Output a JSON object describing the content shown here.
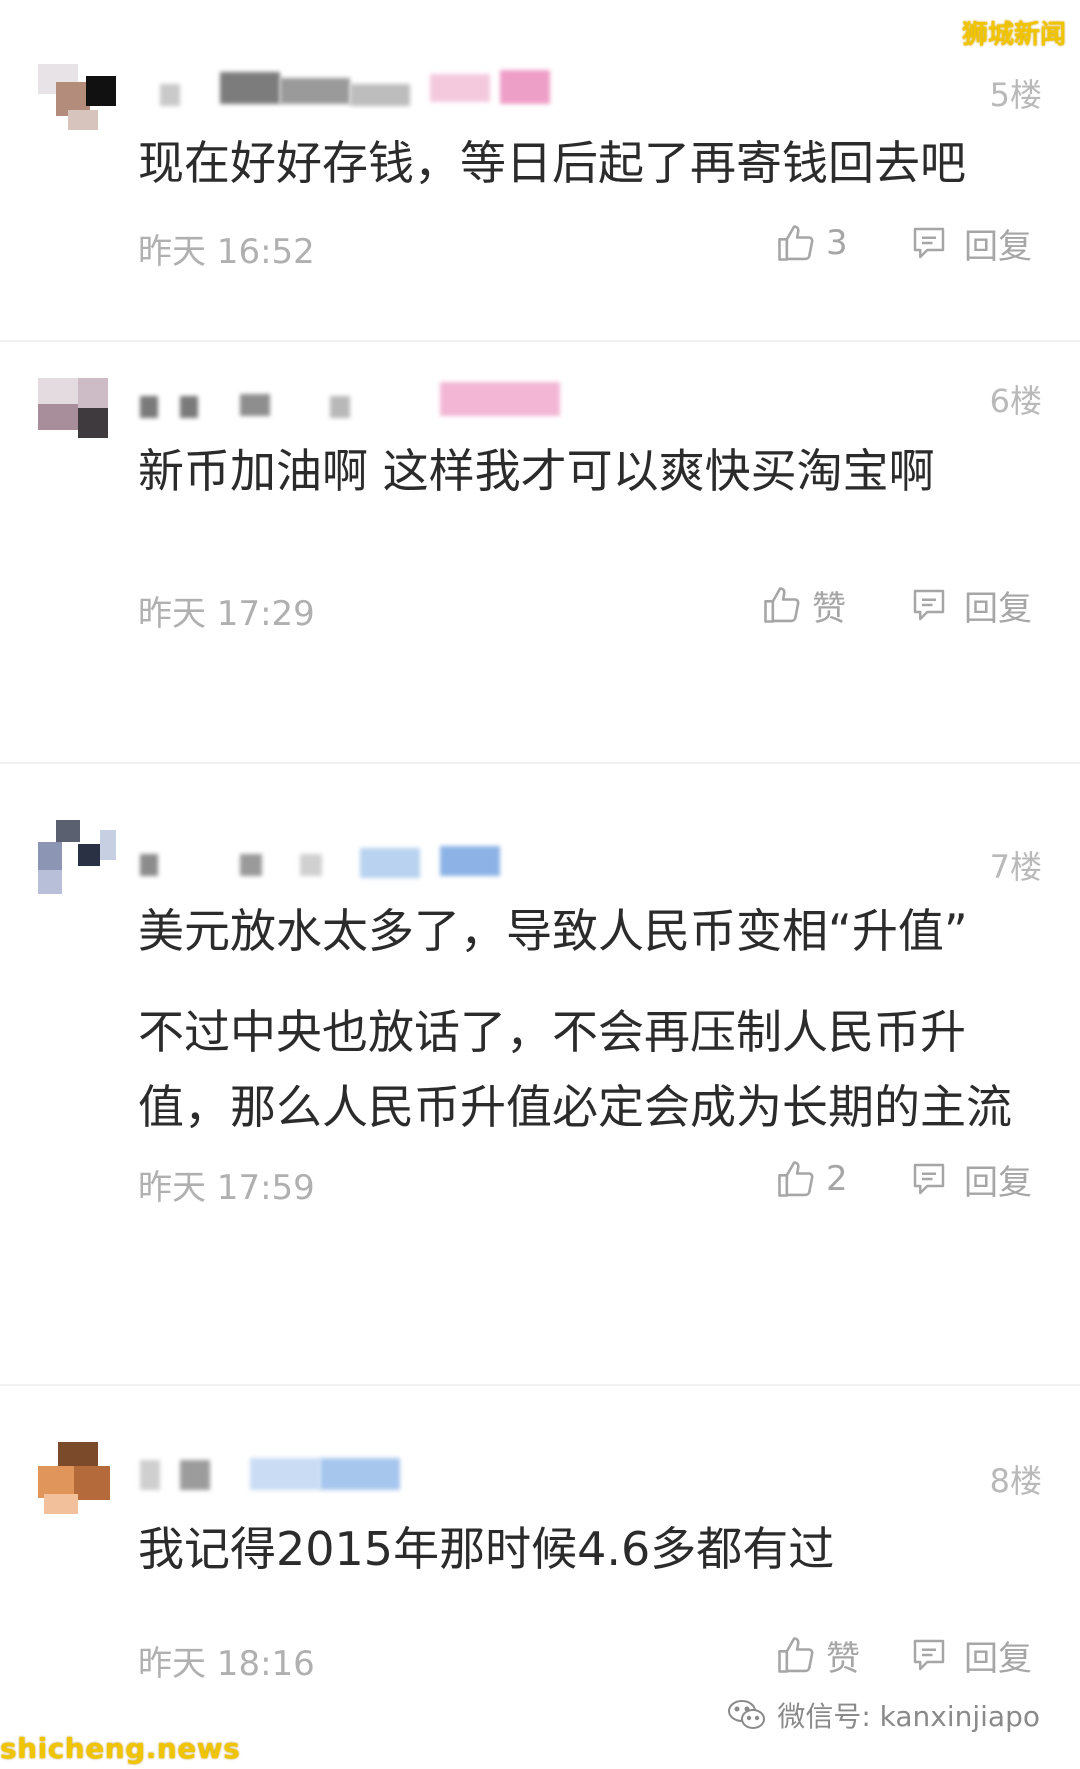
{
  "watermark": {
    "top_right": "狮城新闻",
    "bottom_left": "shicheng.news",
    "bottom_right": "微信号: kanxinjiapo"
  },
  "comments": [
    {
      "floor": "5楼",
      "lines": [
        "现在好好存钱，等日后起了再寄钱回去吧"
      ],
      "time": "昨天 16:52",
      "likes": "3",
      "reply_label": "回复"
    },
    {
      "floor": "6楼",
      "lines": [
        "新币加油啊 这样我才可以爽快买淘宝啊"
      ],
      "time": "昨天 17:29",
      "likes": "赞",
      "reply_label": "回复"
    },
    {
      "floor": "7楼",
      "lines": [
        "美元放水太多了，导致人民币变相“升值”",
        "不过中央也放话了，不会再压制人民币升值，那么人民币升值必定会成为长期的主流"
      ],
      "time": "昨天 17:59",
      "likes": "2",
      "reply_label": "回复"
    },
    {
      "floor": "8楼",
      "lines": [
        "我记得2015年那时候4.6多都有过"
      ],
      "time": "昨天 18:16",
      "likes": "赞",
      "reply_label": "回复"
    }
  ],
  "icons": {
    "like": "thumbs-up-icon",
    "reply": "comment-icon",
    "wechat": "wechat-icon"
  },
  "colors": {
    "watermark": "#f1c400",
    "muted": "#b0b0b0",
    "text": "#2b2b2b"
  }
}
